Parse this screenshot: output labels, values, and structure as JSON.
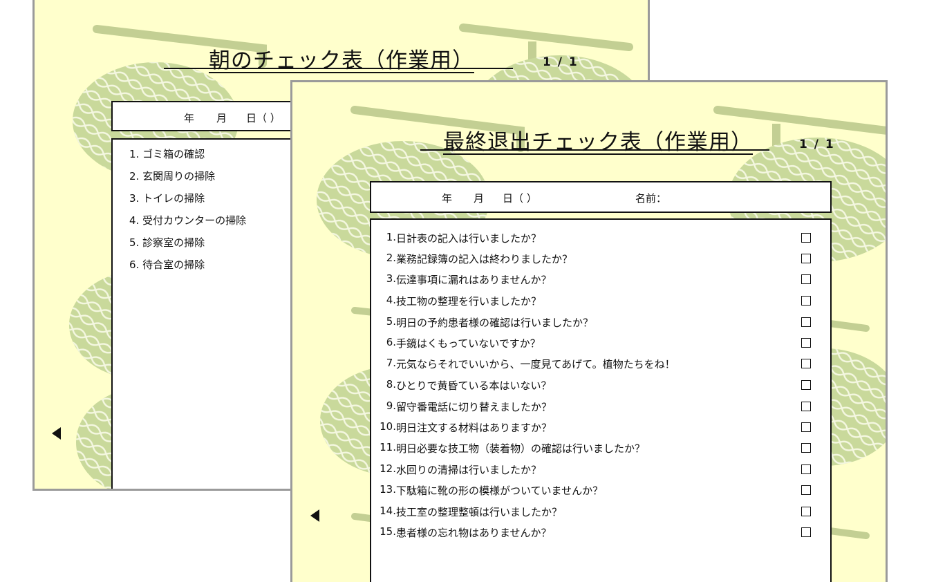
{
  "back_slide": {
    "title": "朝のチェック表（作業用）",
    "page": "1 / 1",
    "date_labels": [
      "年",
      "月",
      "日（ ）"
    ],
    "items": [
      "1. ゴミ箱の確認",
      "2. 玄関周りの掃除",
      "3. トイレの掃除",
      "4. 受付カウンターの掃除",
      "5. 診察室の掃除",
      "6. 待合室の掃除"
    ]
  },
  "front_slide": {
    "title": "最終退出チェック表（作業用）",
    "page": "1 / 1",
    "date_labels": [
      "年",
      "月",
      "日（ ）"
    ],
    "name_label": "名前：",
    "items": [
      {
        "num": "1.",
        "text": "日計表の記入は行いましたか？",
        "checked": false
      },
      {
        "num": "2.",
        "text": "業務記録簿の記入は終わりましたか？",
        "checked": false
      },
      {
        "num": "3.",
        "text": "伝達事項に漏れはありませんか？",
        "checked": false
      },
      {
        "num": "4.",
        "text": "技工物の整理を行いましたか？",
        "checked": false
      },
      {
        "num": "5.",
        "text": "明日の予約患者様の確認は行いましたか？",
        "checked": false
      },
      {
        "num": "6.",
        "text": "手鏡はくもっていないですか？",
        "checked": false
      },
      {
        "num": "7.",
        "text": "元気ならそれでいいから、一度見てあげて。植物たちをね！",
        "checked": false
      },
      {
        "num": "8.",
        "text": "ひとりで黄昏ている本はいない？",
        "checked": false
      },
      {
        "num": "9.",
        "text": "留守番電話に切り替えましたか？",
        "checked": false
      },
      {
        "num": "10.",
        "text": "明日注文する材料はありますか？",
        "checked": false
      },
      {
        "num": "11.",
        "text": "明日必要な技工物（装着物）の確認は行いましたか？",
        "checked": false
      },
      {
        "num": "12.",
        "text": "水回りの清掃は行いましたか？",
        "checked": false
      },
      {
        "num": "13.",
        "text": "下駄箱に靴の形の模様がついていませんか？",
        "checked": false
      },
      {
        "num": "14.",
        "text": "技工室の整理整頓は行いましたか？",
        "checked": false
      },
      {
        "num": "15.",
        "text": "患者様の忘れ物はありませんか？",
        "checked": false
      }
    ]
  },
  "icons": {
    "prev": "triangle-left-icon"
  },
  "colors": {
    "slide_bg": "#ffffcc",
    "melon": "#c9d99b",
    "melon_net": "#f4f7e0",
    "stem": "#c3cf93"
  }
}
